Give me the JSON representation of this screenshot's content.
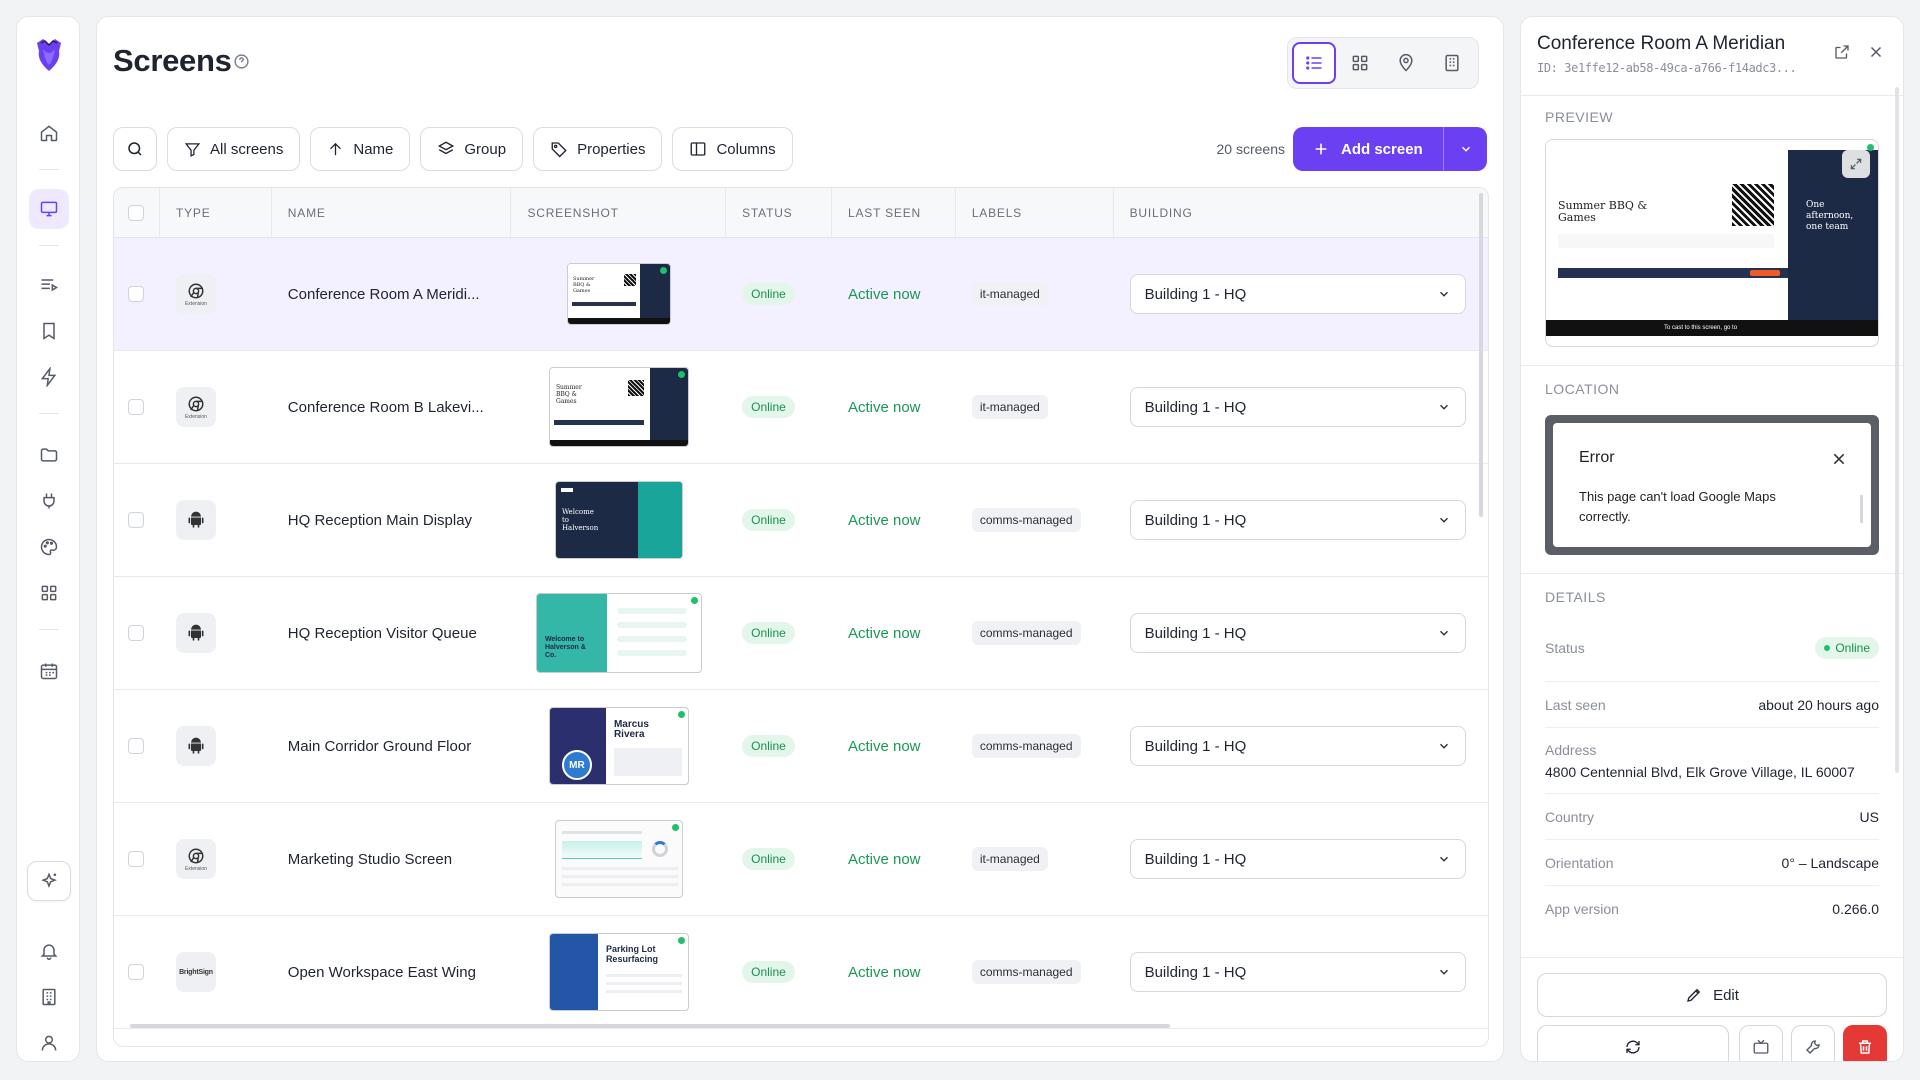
{
  "page": {
    "title": "Screens"
  },
  "toolbar": {
    "filter_label": "All screens",
    "sort_label": "Name",
    "group_label": "Group",
    "properties_label": "Properties",
    "columns_label": "Columns",
    "count_text": "20 screens",
    "add_label": "Add screen"
  },
  "table": {
    "headers": {
      "type": "TYPE",
      "name": "NAME",
      "screenshot": "SCREENSHOT",
      "status": "STATUS",
      "last_seen": "LAST SEEN",
      "labels": "LABELS",
      "building": "BUILDING"
    },
    "rows": [
      {
        "type": "chrome",
        "type_sub": "Extension",
        "name": "Conference Room A Meridi...",
        "status": "Online",
        "last_seen": "Active now",
        "label": "it-managed",
        "building": "Building 1 - HQ",
        "selected": true,
        "thumb_text": "Summer BBQ & Games"
      },
      {
        "type": "chrome",
        "type_sub": "Extension",
        "name": "Conference Room B Lakevi...",
        "status": "Online",
        "last_seen": "Active now",
        "label": "it-managed",
        "building": "Building 1 - HQ",
        "thumb_text": "Summer BBQ & Games"
      },
      {
        "type": "android",
        "name": "HQ Reception Main Display",
        "status": "Online",
        "last_seen": "Active now",
        "label": "comms-managed",
        "building": "Building 1 - HQ",
        "thumb_text": "Welcome to Halverson"
      },
      {
        "type": "android",
        "name": "HQ Reception Visitor Queue",
        "status": "Online",
        "last_seen": "Active now",
        "label": "comms-managed",
        "building": "Building 1 - HQ",
        "thumb_text": "Welcome to Halverson & Co."
      },
      {
        "type": "android",
        "name": "Main Corridor Ground Floor",
        "status": "Online",
        "last_seen": "Active now",
        "label": "comms-managed",
        "building": "Building 1 - HQ",
        "thumb_text": "Marcus Rivera",
        "thumb_initials": "MR"
      },
      {
        "type": "chrome",
        "type_sub": "Extension",
        "name": "Marketing Studio Screen",
        "status": "Online",
        "last_seen": "Active now",
        "label": "it-managed",
        "building": "Building 1 - HQ",
        "thumb_text": ""
      },
      {
        "type": "brightsign",
        "type_text": "BrightSign",
        "name": "Open Workspace East Wing",
        "status": "Online",
        "last_seen": "Active now",
        "label": "comms-managed",
        "building": "Building 1 - HQ",
        "thumb_text": "Parking Lot Resurfacing"
      }
    ]
  },
  "side": {
    "title": "Conference Room A Meridian",
    "id": "ID: 3e1ffe12-ab58-49ca-a766-f14adc3...",
    "preview_label": "PREVIEW",
    "preview": {
      "heading": "Summer BBQ & Games",
      "right_text": "One afternoon, one team",
      "footer": "To cast to this screen, go to"
    },
    "location_label": "LOCATION",
    "map_error": {
      "title": "Error",
      "message": "This page can't load Google Maps correctly."
    },
    "details_label": "DETAILS",
    "details": {
      "status_k": "Status",
      "status_v": "Online",
      "last_seen_k": "Last seen",
      "last_seen_v": "about 20 hours ago",
      "address_k": "Address",
      "address_v": "4800 Centennial Blvd, Elk Grove Village, IL 60007",
      "country_k": "Country",
      "country_v": "US",
      "orientation_k": "Orientation",
      "orientation_v": "0° – Landscape",
      "app_version_k": "App version",
      "app_version_v": "0.266.0"
    },
    "edit_label": "Edit"
  },
  "colors": {
    "accent": "#6b3ff2",
    "online": "#1a9955",
    "danger": "#e53935"
  }
}
